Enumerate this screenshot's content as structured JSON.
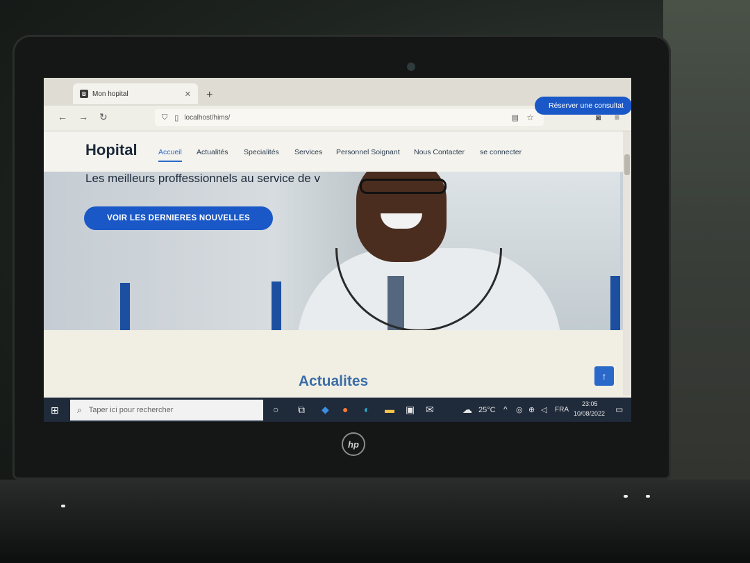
{
  "browser": {
    "tab_title": "Mon hopital",
    "tab_favicon": "B",
    "url": "localhost/hims/"
  },
  "site": {
    "brand": "Hopital",
    "nav": [
      {
        "label": "Accueil",
        "active": true
      },
      {
        "label": "Actualités"
      },
      {
        "label": "Specialités"
      },
      {
        "label": "Services"
      },
      {
        "label": "Personnel Soignant"
      },
      {
        "label": "Nous Contacter"
      },
      {
        "label": "se connecter"
      }
    ],
    "cta_label": "Réserver une consultat"
  },
  "hero": {
    "tagline": "Les meilleurs proffessionnels au service de v",
    "button_label": "VOIR LES DERNIERES NOUVELLES"
  },
  "section": {
    "title": "Actualites"
  },
  "taskbar": {
    "search_placeholder": "Taper ici pour rechercher",
    "weather": "25°C",
    "language": "FRA",
    "time": "23:05",
    "date": "10/08/2022"
  },
  "colors": {
    "primary": "#1a58c7",
    "brand_text": "#1d2a3a",
    "section_title": "#3b6ea8",
    "taskbar": "#1f2a3a"
  },
  "icons": [
    "back-icon",
    "forward-icon",
    "reload-icon",
    "shield-icon",
    "page-icon",
    "reader-icon",
    "star-icon",
    "pocket-icon",
    "menu-icon",
    "arrow-up-icon",
    "windows-icon",
    "search-icon",
    "cortana-icon",
    "task-view-icon",
    "vscode-icon",
    "firefox-icon",
    "edge-icon",
    "explorer-icon",
    "store-icon",
    "mail-icon",
    "cloud-icon",
    "chevron-up-icon",
    "network-icon",
    "volume-icon",
    "notification-icon"
  ]
}
